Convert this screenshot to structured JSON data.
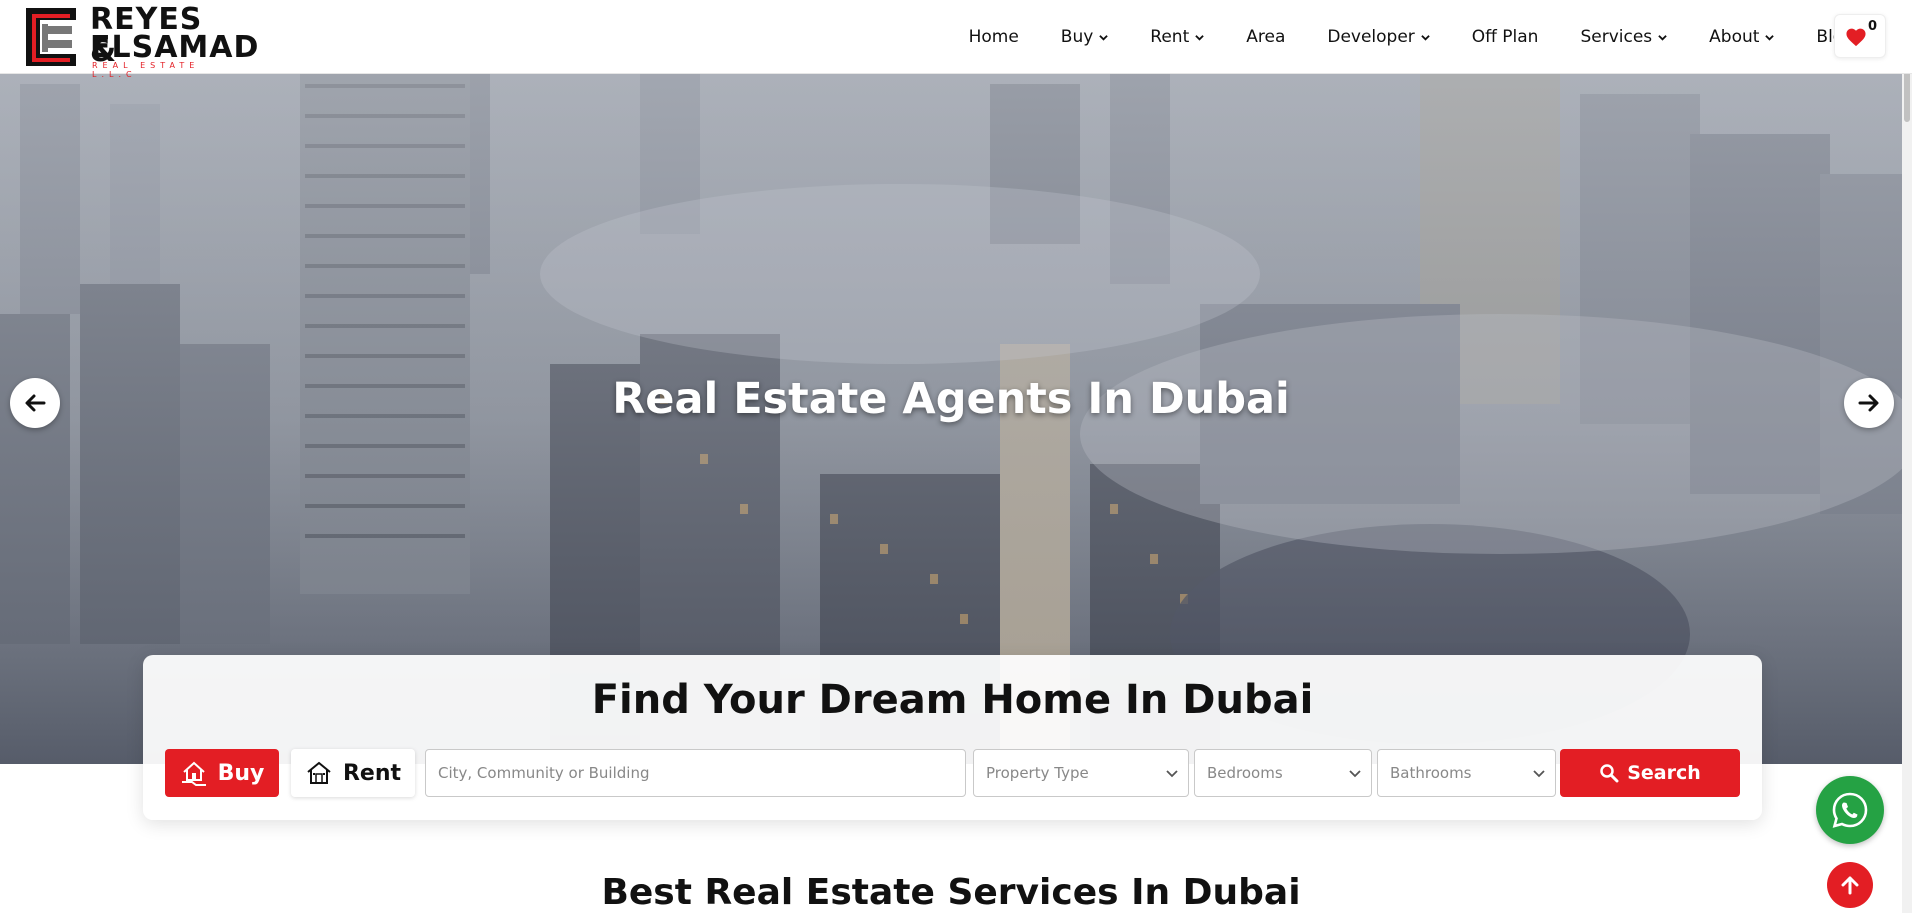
{
  "brand": {
    "line1": "REYES &",
    "line2": "ELSAMAD",
    "line3": "REAL ESTATE L.L.C",
    "accent_color": "#e31e24"
  },
  "nav": {
    "items": [
      {
        "label": "Home",
        "has_dropdown": false
      },
      {
        "label": "Buy",
        "has_dropdown": true
      },
      {
        "label": "Rent",
        "has_dropdown": true
      },
      {
        "label": "Area",
        "has_dropdown": false
      },
      {
        "label": "Developer",
        "has_dropdown": true
      },
      {
        "label": "Off Plan",
        "has_dropdown": false
      },
      {
        "label": "Services",
        "has_dropdown": true
      },
      {
        "label": "About",
        "has_dropdown": true
      },
      {
        "label": "Blog",
        "has_dropdown": false
      }
    ],
    "favorites_count": "0",
    "favorites_icon": "heart-icon"
  },
  "hero": {
    "title": "Real Estate Agents In Dubai",
    "prev_icon": "arrow-left-icon",
    "next_icon": "arrow-right-icon"
  },
  "search": {
    "title": "Find Your Dream Home In Dubai",
    "buy_label": "Buy",
    "rent_label": "Rent",
    "location_placeholder": "City, Community or Building",
    "property_type_label": "Property Type",
    "bedrooms_label": "Bedrooms",
    "bathrooms_label": "Bathrooms",
    "search_label": "Search"
  },
  "services": {
    "title": "Best Real Estate Services In Dubai"
  },
  "floating": {
    "whatsapp_icon": "whatsapp-icon",
    "whatsapp_color": "#25a244",
    "back_to_top_icon": "arrow-up-icon"
  }
}
